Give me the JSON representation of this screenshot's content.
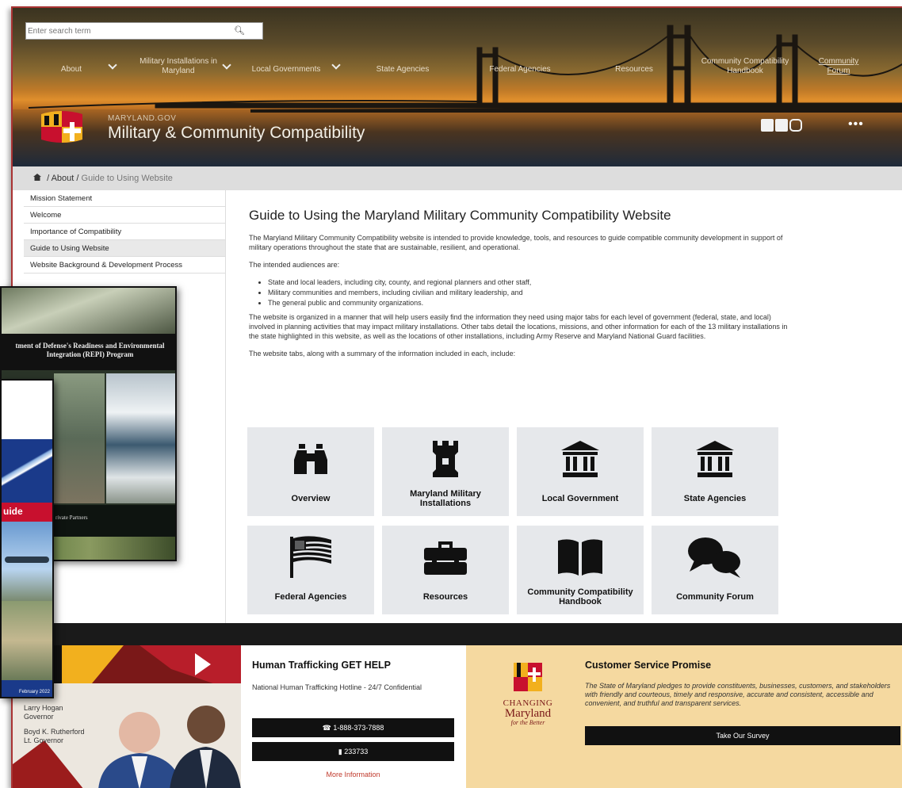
{
  "search": {
    "placeholder": "Enter search term"
  },
  "nav": {
    "about": "About",
    "military_installations": "Military Installations in Maryland",
    "local_governments": "Local Governments",
    "state_agencies": "State Agencies",
    "federal_agencies": "Federal Agencies",
    "resources": "Resources",
    "community_handbook": "Community Compatibility Handbook",
    "community_forum": "Community Forum"
  },
  "brand": {
    "subtitle": "MARYLAND.GOV",
    "title": "Military & Community Compatibility"
  },
  "breadcrumb": {
    "items": [
      "About",
      "Guide to Using Website"
    ],
    "separator": "/"
  },
  "sidebar": {
    "items": [
      {
        "label": "Mission Statement"
      },
      {
        "label": "Welcome"
      },
      {
        "label": "Importance of Compatibility"
      },
      {
        "label": "Guide to Using Website"
      },
      {
        "label": "Website Background & Development Process"
      }
    ]
  },
  "main": {
    "title": "Guide to Using the Maryland Military Community Compatibility Website",
    "intro": "The Maryland Military Community Compatibility website is intended to provide knowledge, tools, and resources to guide compatible community development in support of military operations throughout the state that are sustainable, resilient, and operational.",
    "audiences_lead": "The intended audiences are:",
    "audiences": [
      "State and local leaders, including city, county, and regional planners and other staff,",
      "Military communities and members, including civilian and military leadership, and",
      "The general public and community organizations."
    ],
    "organization": "The website is organized in a manner that will help users easily find the information they need using major tabs for each level of government (federal, state, and local) involved in planning activities that may impact military installations. Other tabs detail the locations, missions, and other information for each of the 13 military installations in the state highlighted in this website, as well as the locations of other installations, including Army Reserve and Maryland National Guard facilities.",
    "tabs_lead": "The website tabs, along with a summary of the information included in each, include:"
  },
  "tiles": [
    {
      "label": "Overview",
      "icon": "binoculars-icon"
    },
    {
      "label": "Maryland Military Installations",
      "icon": "castle-tower-icon"
    },
    {
      "label": "Local Government",
      "icon": "government-building-icon"
    },
    {
      "label": "State Agencies",
      "icon": "government-building-icon"
    },
    {
      "label": "Federal Agencies",
      "icon": "us-flag-icon"
    },
    {
      "label": "Resources",
      "icon": "toolbox-icon"
    },
    {
      "label": "Community Compatibility Handbook",
      "icon": "open-book-icon"
    },
    {
      "label": "Community Forum",
      "icon": "chat-bubbles-icon"
    }
  ],
  "footer": {
    "governor_name": "Larry Hogan",
    "governor_title": "Governor",
    "lt_governor_name": "Boyd K. Rutherford",
    "lt_governor_title": "Lt. Governor",
    "trafficking_title": "Human Trafficking GET HELP",
    "trafficking_text": "National Human Trafficking Hotline - 24/7 Confidential",
    "phone": "1-888-373-7888",
    "text_number": "233733",
    "more_info": "More Information",
    "logo_top": "CHANGING",
    "logo_mid": "Maryland",
    "logo_bot": "for the Better",
    "promise_title": "Customer Service Promise",
    "promise_text": "The State of Maryland pledges to provide constituents, businesses, customers, and stakeholders with friendly and courteous, timely and responsive, accurate and consistent, accessible and convenient, and truthful and transparent services.",
    "survey_button": "Take Our Survey"
  },
  "overlay": {
    "cover1_title": "tment of Defense's Readiness and Environmental Integration (REPI) Program",
    "cover1_footer": "rivate Partners",
    "cover2_band": "uide",
    "cover2_date": "February 2022"
  },
  "colors": {
    "accent_red": "#c8102e",
    "tile_bg": "#e6e8eb",
    "footer_sand": "#f5d9a0",
    "maryland_gold": "#f2b01e"
  }
}
